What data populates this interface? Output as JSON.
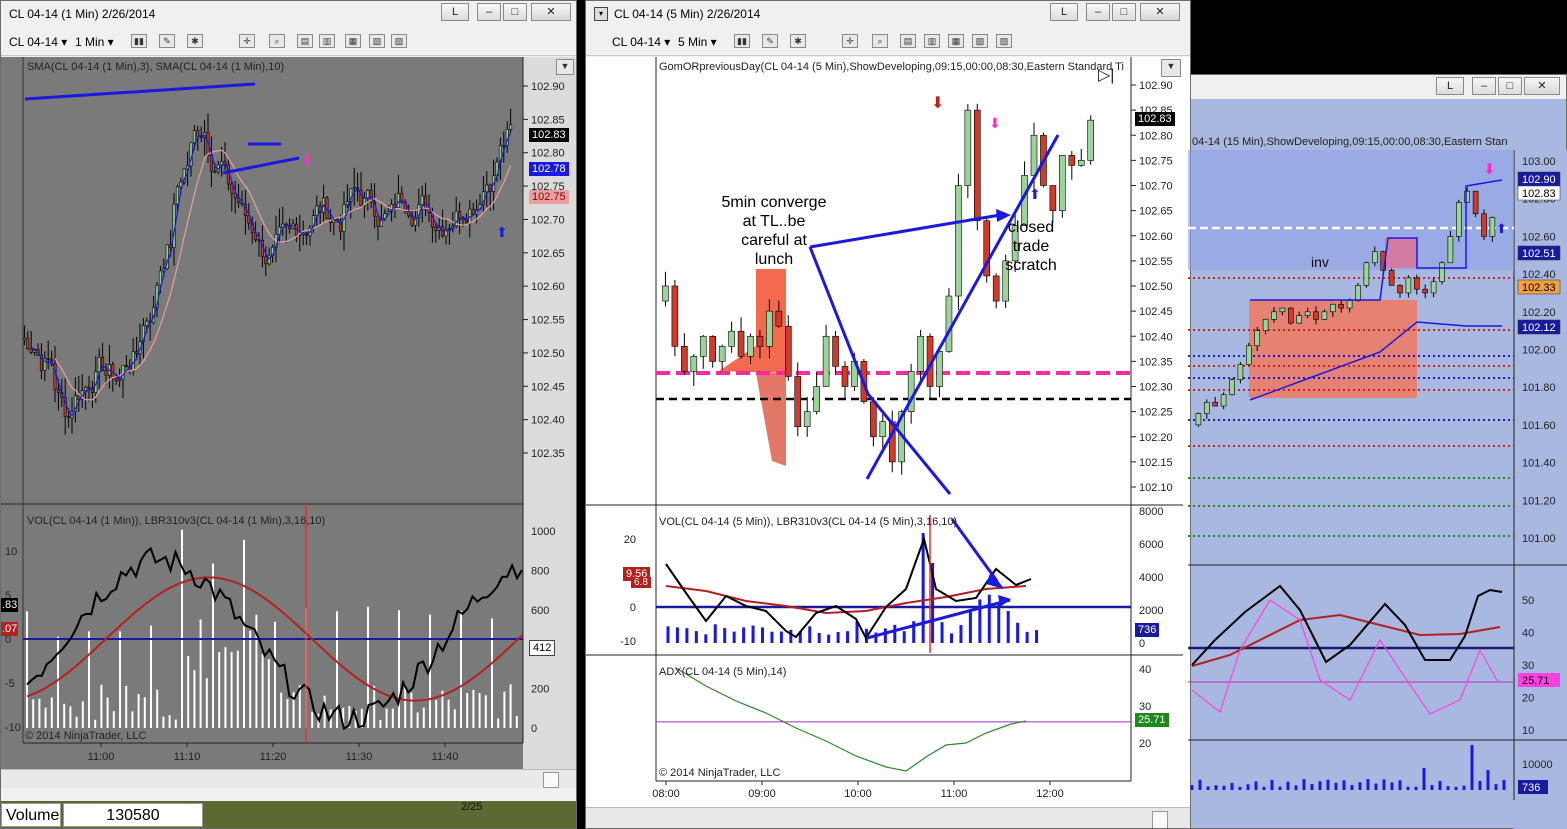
{
  "win1": {
    "title": "CL 04-14 (1 Min)  2/26/2014",
    "instrument": "CL 04-14",
    "interval": "1 Min",
    "panel1_label": "SMA(CL 04-14 (1 Min),3), SMA(CL 04-14 (1 Min),10)",
    "panel2_label": "VOL(CL 04-14 (1 Min)), LBR310v3(CL 04-14 (1 Min),3,16,10)",
    "copyright": "© 2014 NinjaTrader, LLC",
    "price_ticks": [
      "102.90",
      "102.85",
      "102.80",
      "102.75",
      "102.70",
      "102.65",
      "102.60",
      "102.55",
      "102.50",
      "102.45",
      "102.40",
      "102.35"
    ],
    "price_labels": {
      "last": "102.83",
      "sma3": "102.78",
      "sma10": "102.75"
    },
    "vol_ticks": [
      "1000",
      "800",
      "600",
      "400",
      "200",
      "0"
    ],
    "osc_ticks": [
      "10",
      "5",
      "0",
      "-5",
      "-10"
    ],
    "osc_labels": {
      "left_top": ".83",
      "left_bottom": ".07",
      "vol": "412"
    },
    "time_ticks": [
      "11:00",
      "11:10",
      "11:20",
      "11:30",
      "11:40"
    ],
    "volume_label": "Volume",
    "volume_value": "130580",
    "date_footer": "2/25"
  },
  "win2": {
    "title": "CL 04-14 (5 Min)  2/26/2014",
    "instrument": "CL 04-14",
    "interval": "5 Min",
    "panel1_label": "GomORpreviousDay(CL 04-14 (5 Min),ShowDeveloping,09:15,00:00,08:30,Eastern Standard Ti",
    "panel2_label": "VOL(CL 04-14 (5 Min)), LBR310v3(CL 04-14 (5 Min),3,16,10)",
    "panel3_label": "ADX(CL 04-14 (5 Min),14)",
    "copyright": "© 2014 NinjaTrader, LLC",
    "price_ticks": [
      "102.90",
      "102.85",
      "102.80",
      "102.75",
      "102.70",
      "102.65",
      "102.60",
      "102.55",
      "102.50",
      "102.45",
      "102.40",
      "102.35",
      "102.30",
      "102.25",
      "102.20",
      "102.15",
      "102.10"
    ],
    "last_label": "102.83",
    "vol_ticks": [
      "8000",
      "6000",
      "4000",
      "2000",
      "0"
    ],
    "osc_ticks": [
      "20",
      "0",
      "-10"
    ],
    "osc_labels": {
      "a": "9.56",
      "b": "6.8",
      "vol": "736"
    },
    "adx_ticks": [
      "40",
      "30",
      "20"
    ],
    "adx_label": "25.71",
    "time_ticks": [
      "08:00",
      "09:00",
      "10:00",
      "11:00",
      "12:00"
    ],
    "annotation1": "5min converge\nat TL..be\ncareful at\nlunch",
    "annotation2": "closed\ntrade\nscratch"
  },
  "win3": {
    "panel1_label": "04-14 (15 Min),ShowDeveloping,09:15,00:00,08:30,Eastern Stan",
    "price_ticks": [
      "103.00",
      "102.80",
      "102.60",
      "102.40",
      "102.20",
      "102.00",
      "101.80",
      "101.60",
      "101.40",
      "101.20",
      "101.00"
    ],
    "labels": {
      "a": "102.90",
      "b": "102.83",
      "c": "102.51",
      "d": "102.33",
      "e": "102.12"
    },
    "inv": "inv",
    "osc_ticks": [
      "50",
      "40",
      "30",
      "20",
      "10"
    ],
    "osc_label": "25.71",
    "vol_tick": "10000",
    "vol_label": "736"
  },
  "colors": {
    "chart_gray": "#777777",
    "chart_blue_bg": "#a9b8e0",
    "trendline": "#1a1adf",
    "pink_dash": "#ff2b9e",
    "candle_up": "#9bd39b",
    "candle_down": "#d03a2a"
  }
}
